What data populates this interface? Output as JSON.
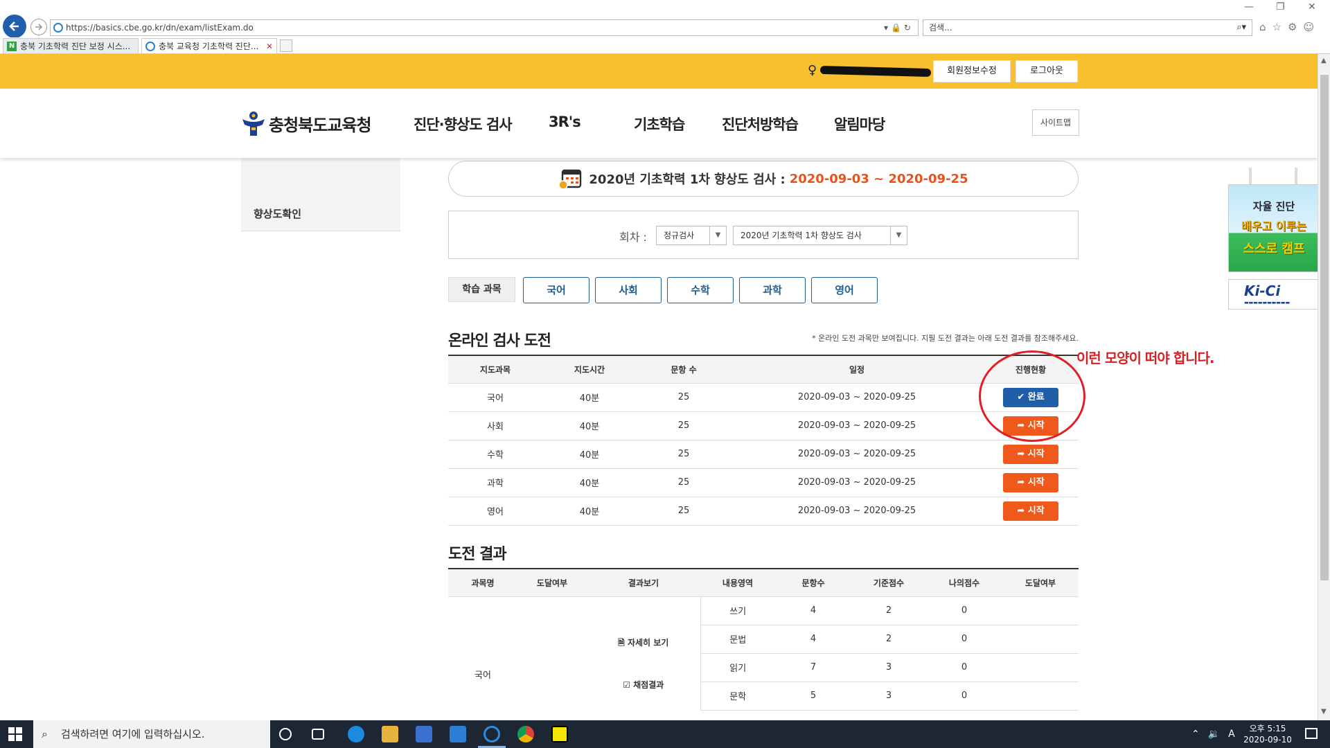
{
  "browser": {
    "url": "https://basics.cbe.go.kr/dn/exam/listExam.do",
    "search_placeholder": "검색...",
    "tabs": [
      {
        "label": "충북 기초학력 진단 보정 시스..."
      },
      {
        "label": "충북 교육청 기초학력 진단..."
      }
    ]
  },
  "topbar": {
    "edit_profile": "회원정보수정",
    "logout": "로그아웃"
  },
  "header": {
    "logo_text": "충청북도교육청",
    "menu": [
      "진단·향상도 검사",
      "3R's",
      "기초학습",
      "진단처방학습",
      "알림마당"
    ],
    "sitemap": "사이트맵"
  },
  "sidebar": {
    "item": "향상도확인"
  },
  "exam": {
    "title": "2020년 기초학력 1차 향상도 검사 :",
    "period": "2020-09-03 ~ 2020-09-25",
    "round_label": "회차 :",
    "round_type": "정규검사",
    "round_name": "2020년 기초학력 1차 향상도 검사"
  },
  "subjects": {
    "label": "학습 과목",
    "items": [
      "국어",
      "사회",
      "수학",
      "과학",
      "영어"
    ]
  },
  "online": {
    "title": "온라인 검사 도전",
    "note": "* 온라인 도전 과목만 보여집니다. 지필 도전 결과는 아래 도전 결과를 참조해주세요.",
    "headers": [
      "지도과목",
      "지도시간",
      "문항 수",
      "일정",
      "진행현황"
    ],
    "rows": [
      {
        "subject": "국어",
        "time": "40분",
        "count": "25",
        "schedule": "2020-09-03 ~ 2020-09-25",
        "status": "완료",
        "status_type": "done"
      },
      {
        "subject": "사회",
        "time": "40분",
        "count": "25",
        "schedule": "2020-09-03 ~ 2020-09-25",
        "status": "시작",
        "status_type": "start"
      },
      {
        "subject": "수학",
        "time": "40분",
        "count": "25",
        "schedule": "2020-09-03 ~ 2020-09-25",
        "status": "시작",
        "status_type": "start"
      },
      {
        "subject": "과학",
        "time": "40분",
        "count": "25",
        "schedule": "2020-09-03 ~ 2020-09-25",
        "status": "시작",
        "status_type": "start"
      },
      {
        "subject": "영어",
        "time": "40분",
        "count": "25",
        "schedule": "2020-09-03 ~ 2020-09-25",
        "status": "시작",
        "status_type": "start"
      }
    ]
  },
  "results": {
    "title": "도전 결과",
    "headers": [
      "과목명",
      "도달여부",
      "결과보기",
      "내용영역",
      "문항수",
      "기준점수",
      "나의점수",
      "도달여부"
    ],
    "subject": "국어",
    "detail_link": "자세히 보기",
    "grading_link": "채점결과",
    "rows": [
      {
        "area": "쓰기",
        "count": "4",
        "base": "2",
        "mine": "0"
      },
      {
        "area": "문법",
        "count": "4",
        "base": "2",
        "mine": "0"
      },
      {
        "area": "읽기",
        "count": "7",
        "base": "3",
        "mine": "0"
      },
      {
        "area": "문학",
        "count": "5",
        "base": "3",
        "mine": "0"
      }
    ]
  },
  "annotation": {
    "text": "이런 모양이 떠야 합니다."
  },
  "banners": {
    "b1_top": "자율 진단",
    "b1_main": "배우고 이루는",
    "b1_sub": "스스로 캠프",
    "b2": "Ki-Ci"
  },
  "taskbar": {
    "search_placeholder": "검색하려면 여기에 입력하십시오.",
    "time": "오후 5:15",
    "date": "2020-09-10",
    "ime": "A"
  },
  "colors": {
    "topbar": "#f7c02c",
    "accent_blue": "#1f5ea8",
    "accent_orange": "#ef5a1c",
    "date_orange": "#e8531d",
    "annotation_red": "#e01e24"
  }
}
